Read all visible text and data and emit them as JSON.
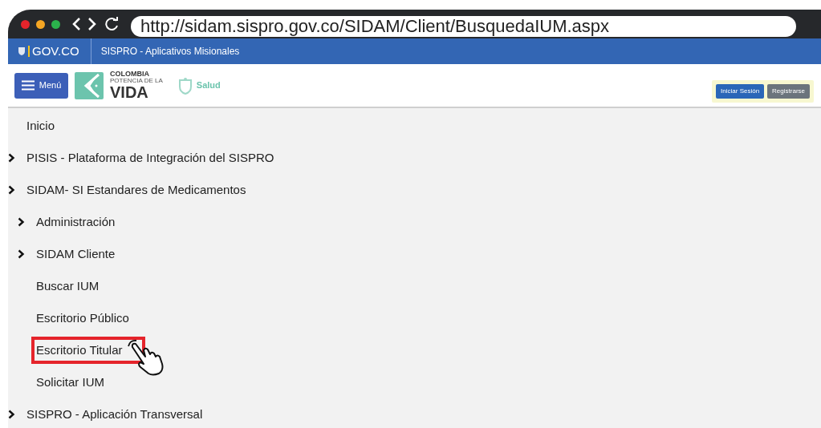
{
  "browser": {
    "url": "http://sidam.sispro.gov.co/SIDAM/Client/BusquedaIUM.aspx"
  },
  "gov_bar": {
    "brand": "GOV.CO",
    "title": "SISPRO - Aplicativos Misionales"
  },
  "header": {
    "menu_button": "Menú",
    "logo_lines": [
      "COLOMBIA",
      "POTENCIA DE LA",
      "VIDA"
    ],
    "ministry": "Salud",
    "buttons": [
      {
        "label": "Iniciar Sesión",
        "kind": "primary"
      },
      {
        "label": "Registrarse",
        "kind": "secondary"
      }
    ]
  },
  "menu": {
    "items": [
      {
        "label": "Inicio",
        "kind": "link",
        "selected": false
      },
      {
        "label": "PISIS - Plataforma de Integración del SISPRO",
        "kind": "folder",
        "selected": false
      },
      {
        "label": "SIDAM- SI Estandares de Medicamentos",
        "kind": "folder",
        "selected": false,
        "children": [
          {
            "label": "Administración",
            "kind": "folder",
            "selected": false
          },
          {
            "label": "SIDAM Cliente",
            "kind": "folder",
            "selected": false
          },
          {
            "label": "Buscar IUM",
            "kind": "link",
            "selected": false
          },
          {
            "label": "Escritorio Público",
            "kind": "link",
            "selected": false
          },
          {
            "label": "Escritorio Titular",
            "kind": "link",
            "selected": true
          },
          {
            "label": "Solicitar IUM",
            "kind": "link",
            "selected": false
          }
        ]
      },
      {
        "label": "SISPRO - Aplicación Transversal",
        "kind": "folder",
        "selected": false
      }
    ]
  }
}
